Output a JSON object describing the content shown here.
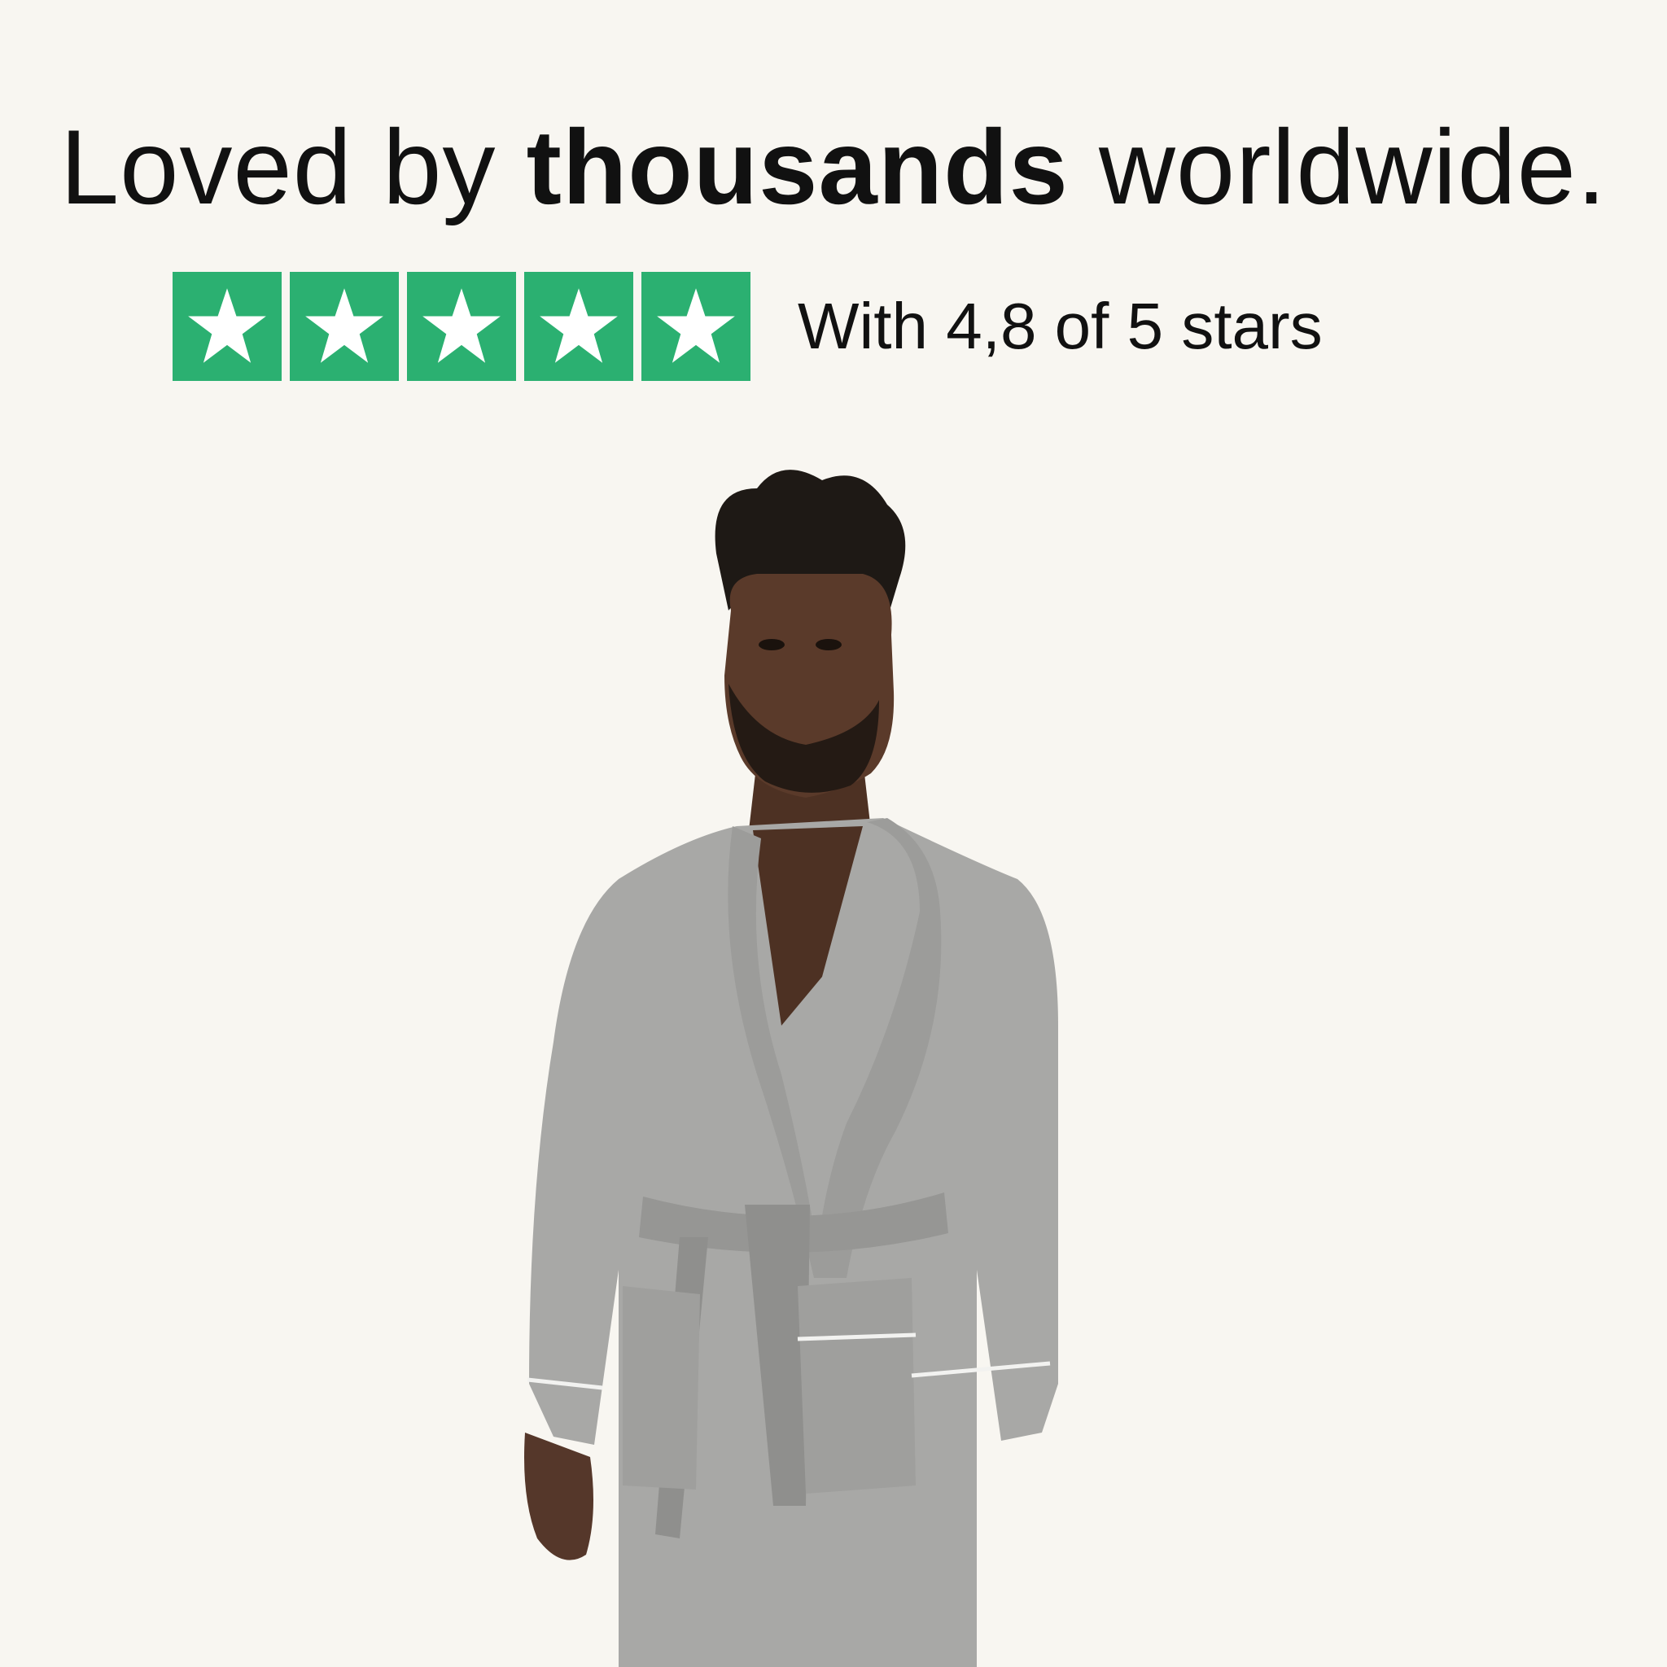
{
  "headline": {
    "prefix": "Loved by ",
    "emphasis": "thousands",
    "suffix": " worldwide."
  },
  "rating": {
    "value": 4.8,
    "max": 5,
    "text": "With 4,8 of 5 stars",
    "star_color": "#2bb071",
    "star_icons": [
      "star-icon",
      "star-icon",
      "star-icon",
      "star-icon",
      "star-icon"
    ]
  },
  "colors": {
    "background": "#f8f6f1",
    "text": "#111111",
    "robe": "#a8a8a6",
    "skin": "#5a3a2a"
  }
}
